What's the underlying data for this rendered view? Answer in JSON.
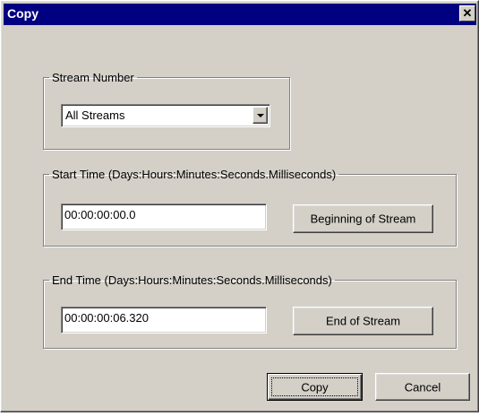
{
  "window": {
    "title": "Copy",
    "close_glyph": "✕"
  },
  "stream_group": {
    "legend": "Stream Number",
    "selected": "All Streams"
  },
  "start_group": {
    "legend": "Start Time (Days:Hours:Minutes:Seconds.Milliseconds)",
    "value": "00:00:00:00.0",
    "button": "Beginning of Stream"
  },
  "end_group": {
    "legend": "End Time (Days:Hours:Minutes:Seconds.Milliseconds)",
    "value": "00:00:00:06.320",
    "button": "End of Stream"
  },
  "footer": {
    "copy_label": "Copy",
    "cancel_label": "Cancel"
  },
  "icons": {
    "close": "close-icon",
    "dropdown": "chevron-down-icon"
  }
}
